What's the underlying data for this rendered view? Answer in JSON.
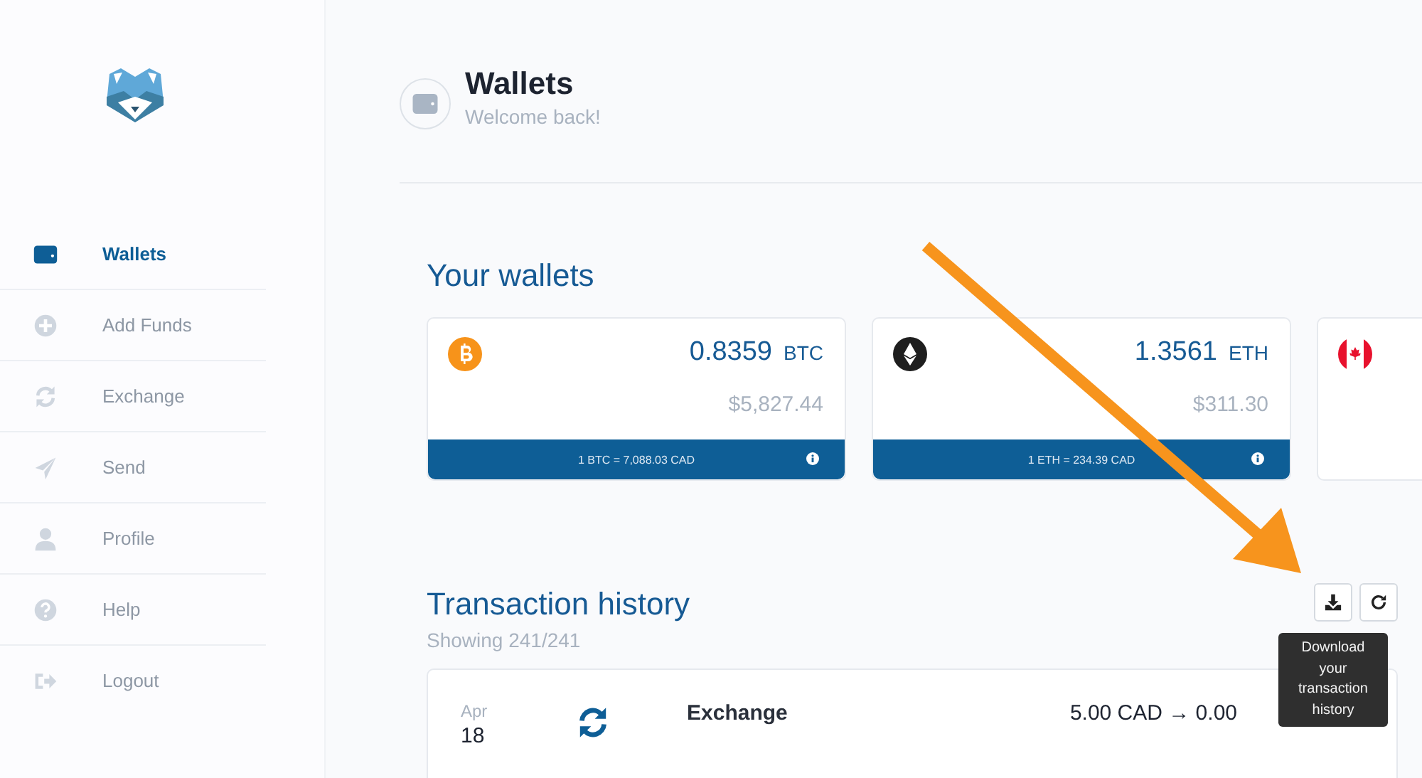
{
  "sidebar": {
    "items": [
      {
        "label": "Wallets",
        "kind": "wallet",
        "selected": true
      },
      {
        "label": "Add Funds",
        "kind": "plus",
        "selected": false
      },
      {
        "label": "Exchange",
        "kind": "sync",
        "selected": false
      },
      {
        "label": "Send",
        "kind": "send",
        "selected": false
      },
      {
        "label": "Profile",
        "kind": "user",
        "selected": false
      },
      {
        "label": "Help",
        "kind": "help",
        "selected": false
      },
      {
        "label": "Logout",
        "kind": "logout",
        "selected": false
      }
    ]
  },
  "header": {
    "title": "Wallets",
    "subtitle": "Welcome back!"
  },
  "wallets": {
    "title": "Your wallets",
    "cards": [
      {
        "kind": "btc",
        "amount": "0.8359",
        "currency": "BTC",
        "value": "$5,827.44",
        "rate": "1 BTC = 7,088.03 CAD"
      },
      {
        "kind": "eth",
        "amount": "1.3561",
        "currency": "ETH",
        "value": "$311.30",
        "rate": "1 ETH = 234.39 CAD"
      },
      {
        "kind": "cad"
      }
    ]
  },
  "history": {
    "title": "Transaction history",
    "count": "Showing 241/241",
    "tooltip": "Download your transaction history",
    "rows": [
      {
        "month": "Apr",
        "day": "18",
        "type": "Exchange",
        "amount": "5.00 CAD → 0.00"
      }
    ]
  }
}
